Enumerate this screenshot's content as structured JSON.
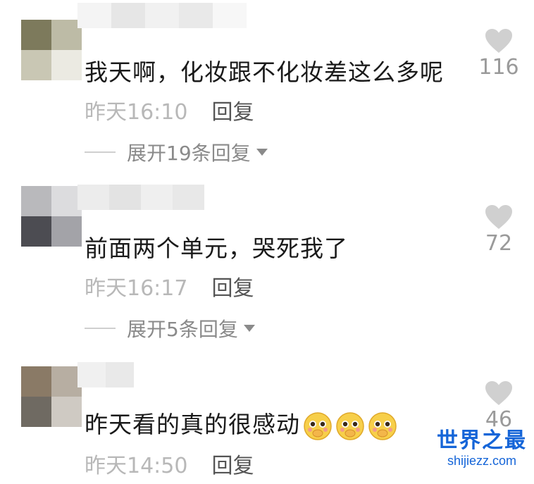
{
  "comments": [
    {
      "text": "我天啊，化妆跟不化妆差这么多呢",
      "time": "昨天16:10",
      "reply_label": "回复",
      "expand_label": "展开19条回复",
      "likes": "116",
      "emoji_count": 0
    },
    {
      "text": "前面两个单元，哭死我了",
      "time": "昨天16:17",
      "reply_label": "回复",
      "expand_label": "展开5条回复",
      "likes": "72",
      "emoji_count": 0
    },
    {
      "text": "昨天看的真的很感动",
      "time": "昨天14:50",
      "reply_label": "回复",
      "expand_label": "",
      "likes": "46",
      "emoji_count": 3
    }
  ],
  "icons": {
    "like": "heart-icon",
    "expand": "caret-down-icon",
    "emoji": "pleading-face-emoji-icon"
  },
  "colors": {
    "text": "#1a1a1a",
    "time": "#b8b8b8",
    "reply": "#555555",
    "heart": "#d0d0d0",
    "watermark": "#1565d8"
  },
  "watermark": {
    "title": "世界之最",
    "url": "shijiezz.com"
  }
}
